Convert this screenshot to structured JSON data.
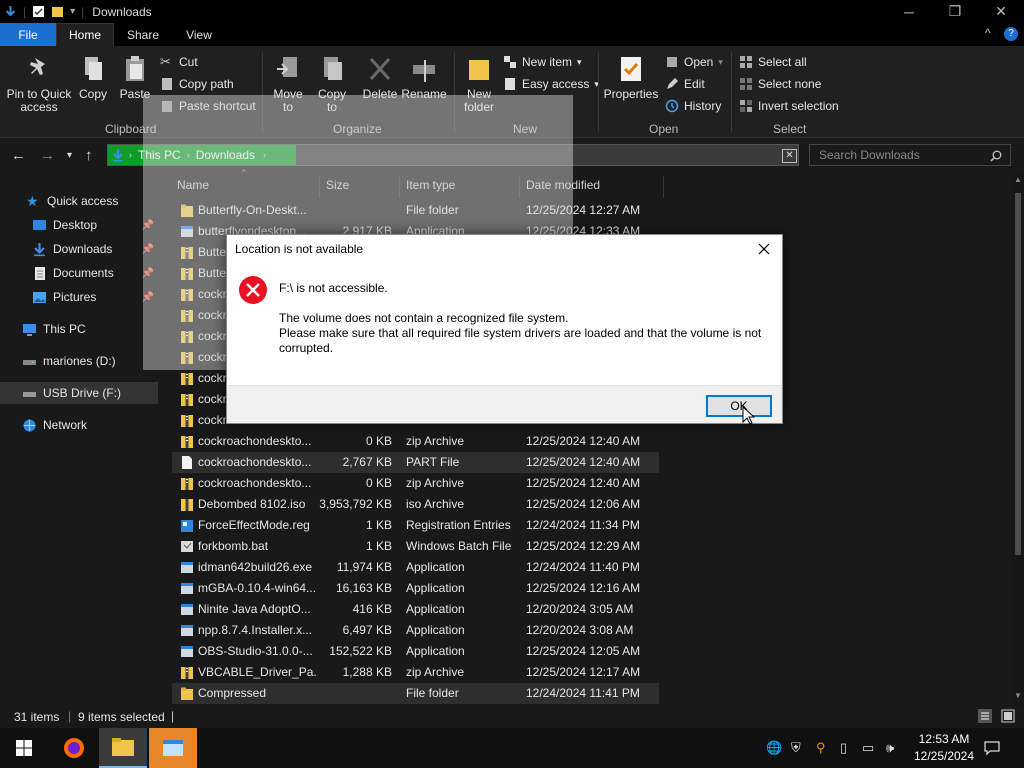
{
  "window": {
    "title": "Downloads",
    "minimize": "─",
    "restore": "❐",
    "close": "✕"
  },
  "tabs": [
    "File",
    "Home",
    "Share",
    "View"
  ],
  "ribbon": {
    "clipboard": {
      "pin_label": "Pin to Quick access",
      "copy_label": "Copy",
      "paste_label": "Paste",
      "cut_label": "Cut",
      "copy_path_label": "Copy path",
      "paste_shortcut_label": "Paste shortcut",
      "group_label": "Clipboard"
    },
    "organize": {
      "move_to_label": "Move to",
      "copy_to_label": "Copy to",
      "delete_label": "Delete",
      "rename_label": "Rename",
      "group_label": "Organize"
    },
    "new": {
      "new_folder_label": "New folder",
      "new_item_label": "New item",
      "easy_access_label": "Easy access",
      "group_label": "New"
    },
    "open": {
      "properties_label": "Properties",
      "open_label": "Open",
      "edit_label": "Edit",
      "history_label": "History",
      "group_label": "Open"
    },
    "select": {
      "select_all_label": "Select all",
      "select_none_label": "Select none",
      "invert_label": "Invert selection",
      "group_label": "Select"
    }
  },
  "address": {
    "crumbs": [
      "This PC",
      "Downloads"
    ],
    "search_placeholder": "Search Downloads"
  },
  "nav": {
    "quick_access": "Quick access",
    "desktop": "Desktop",
    "downloads": "Downloads",
    "documents": "Documents",
    "pictures": "Pictures",
    "this_pc": "This PC",
    "mariones": "mariones (D:)",
    "usb": "USB Drive (F:)",
    "network": "Network"
  },
  "columns": {
    "name": "Name",
    "size": "Size",
    "type": "Item type",
    "date": "Date modified"
  },
  "files": [
    {
      "name": "Butterfly-On-Deskt...",
      "size": "",
      "type": "File folder",
      "date": "12/25/2024 12:27 AM",
      "icon": "folder"
    },
    {
      "name": "butterflyondesktop...",
      "size": "2,917 KB",
      "type": "Application",
      "date": "12/25/2024 12:33 AM",
      "icon": "app"
    },
    {
      "name": "Butte",
      "size": "",
      "type": "",
      "date": "",
      "icon": "zip"
    },
    {
      "name": "Butte",
      "size": "",
      "type": "",
      "date": "",
      "icon": "zip"
    },
    {
      "name": "cockr",
      "size": "",
      "type": "",
      "date": "",
      "icon": "zip"
    },
    {
      "name": "cockr",
      "size": "",
      "type": "",
      "date": "",
      "icon": "zip"
    },
    {
      "name": "cockr",
      "size": "",
      "type": "",
      "date": "",
      "icon": "zip"
    },
    {
      "name": "cockr",
      "size": "",
      "type": "",
      "date": "",
      "icon": "zip"
    },
    {
      "name": "cockr",
      "size": "",
      "type": "",
      "date": "",
      "icon": "zip"
    },
    {
      "name": "cockr",
      "size": "",
      "type": "",
      "date": "",
      "icon": "zip"
    },
    {
      "name": "cockr",
      "size": "",
      "type": "",
      "date": "",
      "icon": "zip"
    },
    {
      "name": "cockroachondeskto...",
      "size": "0 KB",
      "type": "zip Archive",
      "date": "12/25/2024 12:40 AM",
      "icon": "zip"
    },
    {
      "name": "cockroachondeskto...",
      "size": "2,767 KB",
      "type": "PART File",
      "date": "12/25/2024 12:40 AM",
      "icon": "file",
      "selected": true
    },
    {
      "name": "cockroachondeskto...",
      "size": "0 KB",
      "type": "zip Archive",
      "date": "12/25/2024 12:40 AM",
      "icon": "zip"
    },
    {
      "name": "Debombed 8102.iso",
      "size": "3,953,792 KB",
      "type": "iso Archive",
      "date": "12/25/2024 12:06 AM",
      "icon": "iso"
    },
    {
      "name": "ForceEffectMode.reg",
      "size": "1 KB",
      "type": "Registration Entries",
      "date": "12/24/2024 11:34 PM",
      "icon": "reg"
    },
    {
      "name": "forkbomb.bat",
      "size": "1 KB",
      "type": "Windows Batch File",
      "date": "12/25/2024 12:29 AM",
      "icon": "bat"
    },
    {
      "name": "idman642build26.exe",
      "size": "11,974 KB",
      "type": "Application",
      "date": "12/24/2024 11:40 PM",
      "icon": "app"
    },
    {
      "name": "mGBA-0.10.4-win64...",
      "size": "16,163 KB",
      "type": "Application",
      "date": "12/25/2024 12:16 AM",
      "icon": "app"
    },
    {
      "name": "Ninite Java AdoptO...",
      "size": "416 KB",
      "type": "Application",
      "date": "12/20/2024 3:05 AM",
      "icon": "app"
    },
    {
      "name": "npp.8.7.4.Installer.x...",
      "size": "6,497 KB",
      "type": "Application",
      "date": "12/20/2024 3:08 AM",
      "icon": "app"
    },
    {
      "name": "OBS-Studio-31.0.0-...",
      "size": "152,522 KB",
      "type": "Application",
      "date": "12/25/2024 12:05 AM",
      "icon": "app"
    },
    {
      "name": "VBCABLE_Driver_Pa...",
      "size": "1,288 KB",
      "type": "zip Archive",
      "date": "12/25/2024 12:17 AM",
      "icon": "zip"
    },
    {
      "name": "Compressed",
      "size": "",
      "type": "File folder",
      "date": "12/24/2024 11:41 PM",
      "icon": "folder",
      "selected": true
    }
  ],
  "status": {
    "items": "31 items",
    "selected": "9 items selected"
  },
  "dialog": {
    "title": "Location is not available",
    "heading": "F:\\ is not accessible.",
    "message1": "The volume does not contain a recognized file system.",
    "message2": "Please make sure that all required file system drivers are loaded and that the volume is not corrupted.",
    "ok_label": "OK"
  },
  "taskbar": {
    "time": "12:53 AM",
    "date": "12/25/2024"
  },
  "colors": {
    "accent": "#1a6fcf",
    "address_green": "#0f9d28",
    "error_red": "#e81123",
    "folder_yellow": "#f0c64a"
  }
}
